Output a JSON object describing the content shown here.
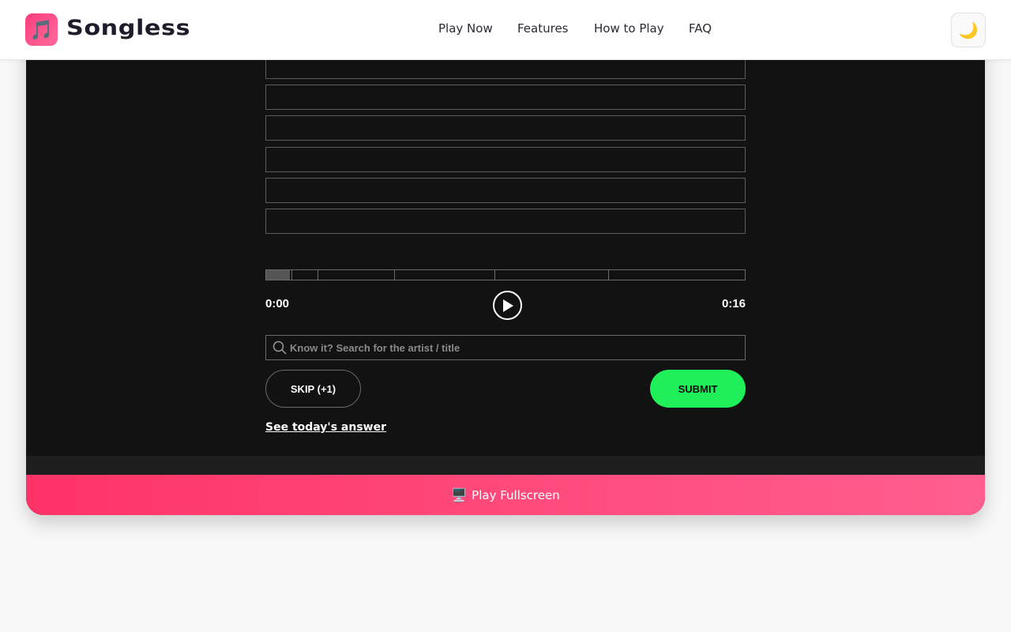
{
  "header": {
    "brand": "Songless",
    "logo_icon": "music-note-icon",
    "nav": [
      "Play Now",
      "Features",
      "How to Play",
      "FAQ"
    ],
    "theme_toggle_icon": "moon-icon"
  },
  "game": {
    "guess_rows": [
      "",
      "",
      "",
      "",
      "",
      ""
    ],
    "time_current": "0:00",
    "time_total": "0:16",
    "progress": 0.05,
    "search_placeholder": "Know it? Search for the artist / title",
    "skip_label": "SKIP (+1)",
    "submit_label": "SUBMIT",
    "answer_link": "See today's answer",
    "fullscreen_label": "Play Fullscreen",
    "fullscreen_icon": "monitor-icon"
  },
  "colors": {
    "accent_pink": "#ff3d7f",
    "submit_green": "#1ff05a",
    "game_background": "#121212"
  }
}
